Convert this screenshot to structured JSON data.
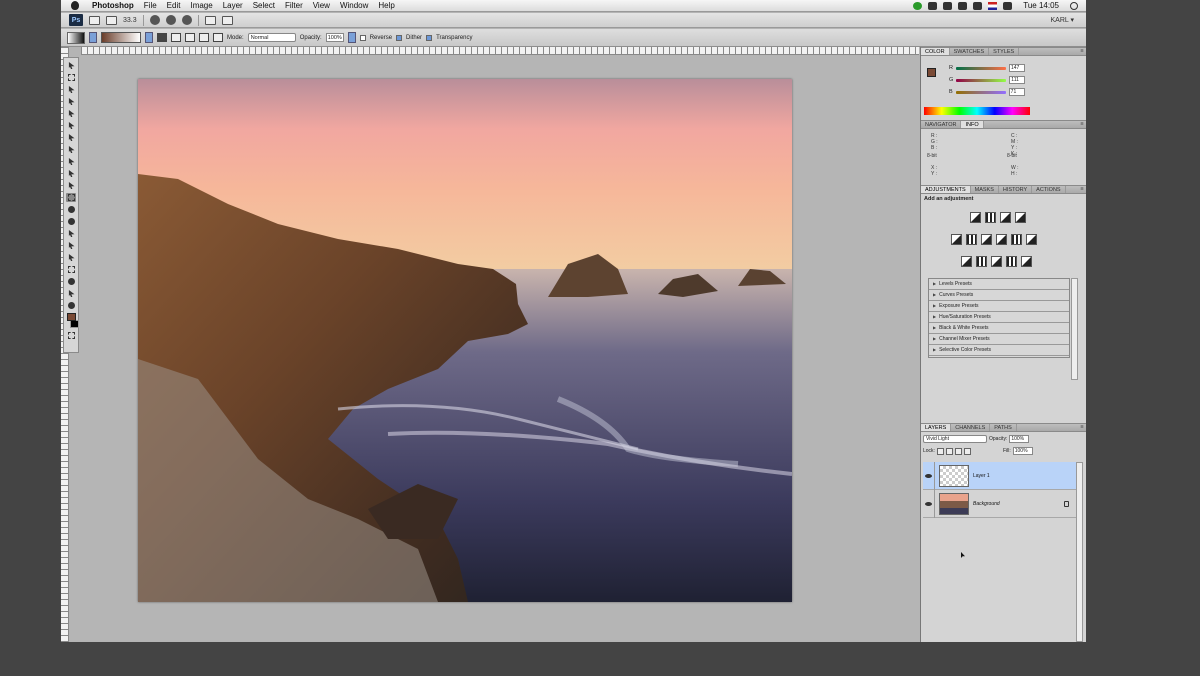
{
  "menubar": {
    "app": "Photoshop",
    "items": [
      "File",
      "Edit",
      "Image",
      "Layer",
      "Select",
      "Filter",
      "View",
      "Window",
      "Help"
    ],
    "clock": "Tue 14:05"
  },
  "appbar": {
    "logo": "Ps",
    "zoom": "33.3",
    "user": "KARL ▾"
  },
  "options": {
    "mode_label": "Mode:",
    "mode_value": "Normal",
    "opacity_label": "Opacity:",
    "opacity_value": "100%",
    "reverse_label": "Reverse",
    "dither_label": "Dither",
    "transparency_label": "Transparency",
    "reverse_checked": false,
    "dither_checked": true,
    "transparency_checked": true
  },
  "color_panel": {
    "tabs": [
      "COLOR",
      "SWATCHES",
      "STYLES"
    ],
    "r": {
      "label": "R",
      "value": "147"
    },
    "g": {
      "label": "G",
      "value": "111"
    },
    "b": {
      "label": "B",
      "value": "71"
    }
  },
  "info_panel": {
    "tabs": [
      "NAVIGATOR",
      "INFO"
    ],
    "left_rgb": "R :\nG :\nB :",
    "left_bit": "8-bit",
    "right_cmyk": "C :\nM :\nY :\nK :",
    "right_bit": "8-bit",
    "xy": "X :\nY :",
    "wh": "W :\nH :"
  },
  "adjust_panel": {
    "tabs": [
      "ADJUSTMENTS",
      "MASKS",
      "HISTORY",
      "ACTIONS"
    ],
    "title": "Add an adjustment",
    "presets": [
      "Levels Presets",
      "Curves Presets",
      "Exposure Presets",
      "Hue/Saturation Presets",
      "Black & White Presets",
      "Channel Mixer Presets",
      "Selective Color Presets"
    ]
  },
  "layers_panel": {
    "tabs": [
      "LAYERS",
      "CHANNELS",
      "PATHS"
    ],
    "blend_mode": "Vivid Light",
    "opacity_label": "Opacity:",
    "opacity_value": "100%",
    "lock_label": "Lock:",
    "fill_label": "Fill:",
    "fill_value": "100%",
    "layers": [
      {
        "name": "Layer 1",
        "selected": true
      },
      {
        "name": "Background",
        "selected": false
      }
    ]
  },
  "colors": {
    "foreground": "#7a4a35",
    "background": "#000000",
    "selection": "#b9d3f8"
  },
  "icons": {
    "menubar": [
      "apple-logo-icon",
      "sync-icon",
      "screen-icon",
      "bluetooth-icon",
      "time-machine-icon",
      "wifi-icon",
      "flag-icon",
      "volume-icon",
      "spotlight-icon"
    ],
    "toolbox": [
      "move-icon",
      "marquee-icon",
      "lasso-icon",
      "quick-select-icon",
      "crop-icon",
      "eyedropper-icon",
      "healing-icon",
      "brush-icon",
      "clone-stamp-icon",
      "history-brush-icon",
      "eraser-icon",
      "gradient-icon",
      "blur-icon",
      "dodge-icon",
      "pen-icon",
      "type-icon",
      "path-select-icon",
      "shape-icon",
      "3d-rotate-icon",
      "hand-icon",
      "zoom-icon"
    ]
  }
}
